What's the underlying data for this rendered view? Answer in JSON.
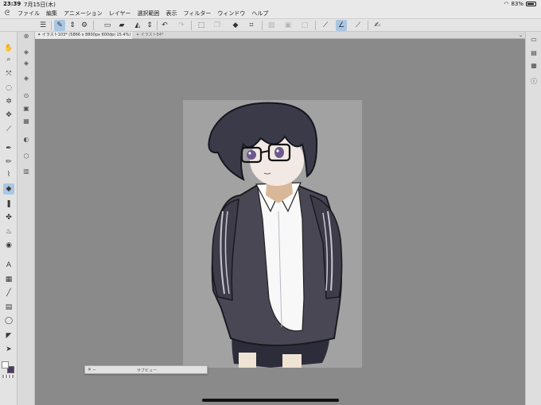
{
  "status_bar": {
    "time": "23:39",
    "date": "7月15日(木)",
    "battery": "83%"
  },
  "menu": {
    "items": [
      "ファイル",
      "編集",
      "アニメーション",
      "レイヤー",
      "選択範囲",
      "表示",
      "フィルター",
      "ウィンドウ",
      "ヘルプ"
    ]
  },
  "tabs": [
    {
      "label": "✦ イラスト103* (5866 x 8800px 600dpi 15.4%)"
    },
    {
      "label": "✦ イラスト84*"
    }
  ],
  "subview": {
    "title": "サブビュー",
    "controls": "✕  ⎯"
  },
  "colors": {
    "main": "#ffffff",
    "sub": "#4d3a63",
    "accent": "#a9c6e4"
  },
  "icons": {
    "toolbar": [
      "menu-icon",
      "pen-tool-icon",
      "up-down-icon",
      "settings-icon",
      "new-canvas-icon",
      "open-icon",
      "save-icon",
      "clear-icon",
      "stepper-icon",
      "undo-icon",
      "redo-icon",
      "lasso-icon",
      "copy-icon",
      "fill-icon",
      "crop-icon",
      "deselect-icon",
      "invert-icon",
      "frame-icon",
      "snap-ruler-icon",
      "snap-line-icon",
      "snap-guide-icon",
      "edit-icon"
    ]
  }
}
